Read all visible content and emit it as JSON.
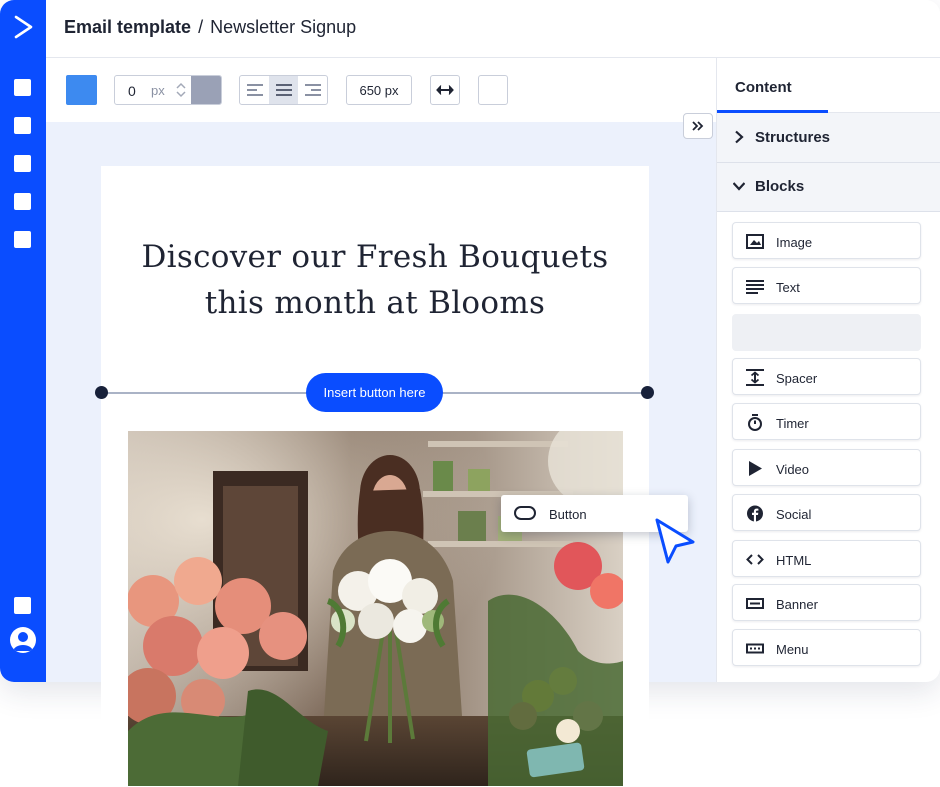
{
  "header": {
    "title_bold": "Email template",
    "title_separator": "/",
    "title_rest": "Newsletter Signup"
  },
  "toolbar": {
    "background_color": "#3d8af0",
    "padding_value": "0",
    "padding_unit": "px",
    "width_value": "650 px",
    "alignment_selected": "center"
  },
  "rail": {
    "logo_icon": "activecampaign-chevron-icon",
    "nav_items": [
      "nav-square-1",
      "nav-square-2",
      "nav-square-3",
      "nav-square-4",
      "nav-square-5",
      "nav-square-6"
    ],
    "accent": "#0a4dff"
  },
  "panel": {
    "tab_label": "Content",
    "accordion": [
      {
        "label": "Structures",
        "expanded": false
      },
      {
        "label": "Blocks",
        "expanded": true
      }
    ],
    "blocks": [
      {
        "label": "Image",
        "icon": "image-icon"
      },
      {
        "label": "Text",
        "icon": "text-lines-icon"
      },
      {
        "label": "",
        "icon": ""
      },
      {
        "label": "Spacer",
        "icon": "spacer-icon"
      },
      {
        "label": "Timer",
        "icon": "timer-icon"
      },
      {
        "label": "Video",
        "icon": "play-icon"
      },
      {
        "label": "Social",
        "icon": "facebook-icon"
      },
      {
        "label": "HTML",
        "icon": "code-icon"
      },
      {
        "label": "Banner",
        "icon": "banner-icon"
      },
      {
        "label": "Menu",
        "icon": "menu-icon"
      }
    ]
  },
  "email": {
    "headline_line1": "Discover our Fresh Bouquets",
    "headline_line2": "this month at Blooms",
    "insert_button_label": "Insert button here",
    "photo_alt": "woman-arranging-bouquet"
  },
  "drag": {
    "chip_label": "Button",
    "chip_icon": "button-pill-icon",
    "cursor_icon": "pointer-cursor-icon"
  }
}
